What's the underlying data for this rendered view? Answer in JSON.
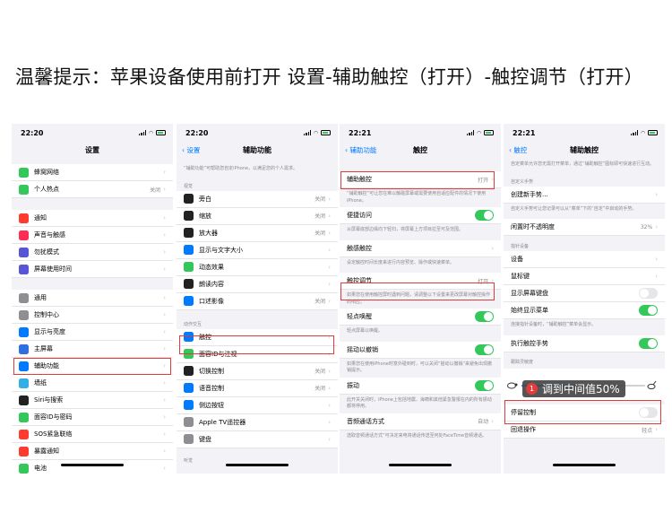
{
  "headline": "温馨提示：苹果设备使用前打开 设置-辅助触控（打开）-触控调节（打开）",
  "colors": {
    "highlight": "#e23b3b",
    "accent": "#007aff",
    "toggle_on": "#34c759"
  },
  "screen1": {
    "time": "22:20",
    "title": "设置",
    "items": [
      {
        "label": "蜂窝网络",
        "value": "",
        "icon": "antenna-icon",
        "color": "#34c759"
      },
      {
        "label": "个人热点",
        "value": "关闭",
        "icon": "hotspot-icon",
        "color": "#34c759"
      },
      {
        "label": "通知",
        "value": "",
        "icon": "bell-icon",
        "color": "#ff3b30"
      },
      {
        "label": "声音与触感",
        "value": "",
        "icon": "speaker-icon",
        "color": "#ff2d55"
      },
      {
        "label": "勿扰模式",
        "value": "",
        "icon": "moon-icon",
        "color": "#5856d6"
      },
      {
        "label": "屏幕使用时间",
        "value": "",
        "icon": "hourglass-icon",
        "color": "#5856d6"
      },
      {
        "label": "通用",
        "value": "",
        "icon": "gear-icon",
        "color": "#8e8e93"
      },
      {
        "label": "控制中心",
        "value": "",
        "icon": "switches-icon",
        "color": "#8e8e93"
      },
      {
        "label": "显示与亮度",
        "value": "",
        "icon": "text-size-icon",
        "color": "#007aff"
      },
      {
        "label": "主屏幕",
        "value": "",
        "icon": "grid-icon",
        "color": "#2f6fe0"
      },
      {
        "label": "辅助功能",
        "value": "",
        "icon": "accessibility-icon",
        "color": "#007aff"
      },
      {
        "label": "墙纸",
        "value": "",
        "icon": "flower-icon",
        "color": "#32ade6"
      },
      {
        "label": "Siri与搜索",
        "value": "",
        "icon": "siri-icon",
        "color": "#222222"
      },
      {
        "label": "面容ID与密码",
        "value": "",
        "icon": "face-id-icon",
        "color": "#34c759"
      },
      {
        "label": "SOS紧急联络",
        "value": "",
        "icon": "sos-icon",
        "color": "#ff3b30"
      },
      {
        "label": "暴露通知",
        "value": "",
        "icon": "virus-icon",
        "color": "#ff3b30"
      },
      {
        "label": "电池",
        "value": "",
        "icon": "battery-icon",
        "color": "#34c759"
      }
    ]
  },
  "screen2": {
    "time": "22:20",
    "back": "设置",
    "title": "辅助功能",
    "desc": "“辅助功能”可帮助您自定iPhone，以满足您的个人需求。",
    "section_vision": "视觉",
    "vision": [
      {
        "label": "旁白",
        "value": "关闭",
        "icon": "voiceover-icon",
        "color": "#222222"
      },
      {
        "label": "缩放",
        "value": "关闭",
        "icon": "zoom-icon",
        "color": "#222222"
      },
      {
        "label": "放大器",
        "value": "关闭",
        "icon": "magnifier-icon",
        "color": "#222222"
      },
      {
        "label": "显示与文字大小",
        "value": "",
        "icon": "text-size-icon",
        "color": "#007aff"
      },
      {
        "label": "动态效果",
        "value": "",
        "icon": "motion-icon",
        "color": "#34c759"
      },
      {
        "label": "朗读内容",
        "value": "",
        "icon": "speech-bubble-icon",
        "color": "#222222"
      },
      {
        "label": "口述影像",
        "value": "关闭",
        "icon": "audio-description-icon",
        "color": "#007aff"
      }
    ],
    "section_motor": "动作交互",
    "motor": [
      {
        "label": "触控",
        "value": "",
        "icon": "hand-icon",
        "color": "#007aff"
      },
      {
        "label": "面容ID与注视",
        "value": "",
        "icon": "face-id-icon",
        "color": "#34c759"
      },
      {
        "label": "切换控制",
        "value": "关闭",
        "icon": "switch-control-icon",
        "color": "#222222"
      },
      {
        "label": "语音控制",
        "value": "关闭",
        "icon": "voice-control-icon",
        "color": "#007aff"
      },
      {
        "label": "侧边按钮",
        "value": "",
        "icon": "side-button-icon",
        "color": "#007aff"
      },
      {
        "label": "Apple TV遥控器",
        "value": "",
        "icon": "remote-icon",
        "color": "#8e8e93"
      },
      {
        "label": "键盘",
        "value": "",
        "icon": "keyboard-icon",
        "color": "#8e8e93"
      }
    ],
    "section_hearing": "听觉"
  },
  "screen3": {
    "time": "22:21",
    "back": "辅助功能",
    "title": "触控",
    "assistive": {
      "label": "辅助触控",
      "value": "打开"
    },
    "assistive_desc": "“辅助触控”可让您在难以触碰屏幕或需要使用自适应配件的情况下使用iPhone。",
    "reachability": {
      "label": "便捷访问"
    },
    "reachability_desc": "从屏幕底部边缘向下轻扫，将屏幕上方项目拉至可及范围。",
    "haptic": {
      "label": "触感触控"
    },
    "haptic_desc": "设定触控时间长度来进行内容预览、操作或快速菜单。",
    "accommodations": {
      "label": "触控调节",
      "value": "打开"
    },
    "accommodations_desc": "如果您在使用触控屏时遇到问题，请调整以下设置来更改屏幕对触控操作的响应。",
    "tap_to_wake": {
      "label": "轻点唤醒"
    },
    "tap_to_wake_desc": "轻点屏幕以唤醒。",
    "shake_undo": {
      "label": "摇动以撤销"
    },
    "shake_undo_desc": "如果您在使用iPhone时意外碰到时，可以关闭“摇动以撤销”来避免出现撤销提示。",
    "vibration": {
      "label": "振动"
    },
    "vibration_desc": "此开关关闭时，iPhone上包括地震、海啸和其他紧急警报在内的所有振动都将停用。",
    "call_audio": {
      "label": "音频通话方式",
      "value": "自动"
    },
    "call_audio_desc": "选取音频通话方式“可决定来电将通话传送至何处FaceTime音频通话。"
  },
  "screen4": {
    "time": "22:21",
    "back": "触控",
    "title": "辅助触控",
    "intro": "自定菜单允许您无需打开菜单，通过“辅助触控”图标即可快速进行互动。",
    "section_custom": "自定义手势",
    "create_gesture": {
      "label": "创建新手势..."
    },
    "create_desc": "自定义手势可让您记录可以从“菜单”下的“自定”中启动的手势。",
    "idle_opacity": {
      "label": "闲置时不透明度",
      "value": "32%"
    },
    "section_pointer": "指针设备",
    "devices": {
      "label": "设备"
    },
    "mouse_keys": {
      "label": "鼠标键"
    },
    "show_keyboard": {
      "label": "显示屏幕键盘"
    },
    "always_menu": {
      "label": "始终显示菜单"
    },
    "always_desc": "连接指针设备时，“辅助触控”菜单会显示。",
    "perform_gestures": {
      "label": "执行触控手势"
    },
    "tracking_label": "跟踪灵敏度",
    "tip_number": "1",
    "tip_text": "调到中间值50%",
    "tracking_value": 0.5,
    "dwell": {
      "label": "停留控制"
    },
    "fallback": {
      "label": "回退操作",
      "value": "轻点"
    }
  }
}
